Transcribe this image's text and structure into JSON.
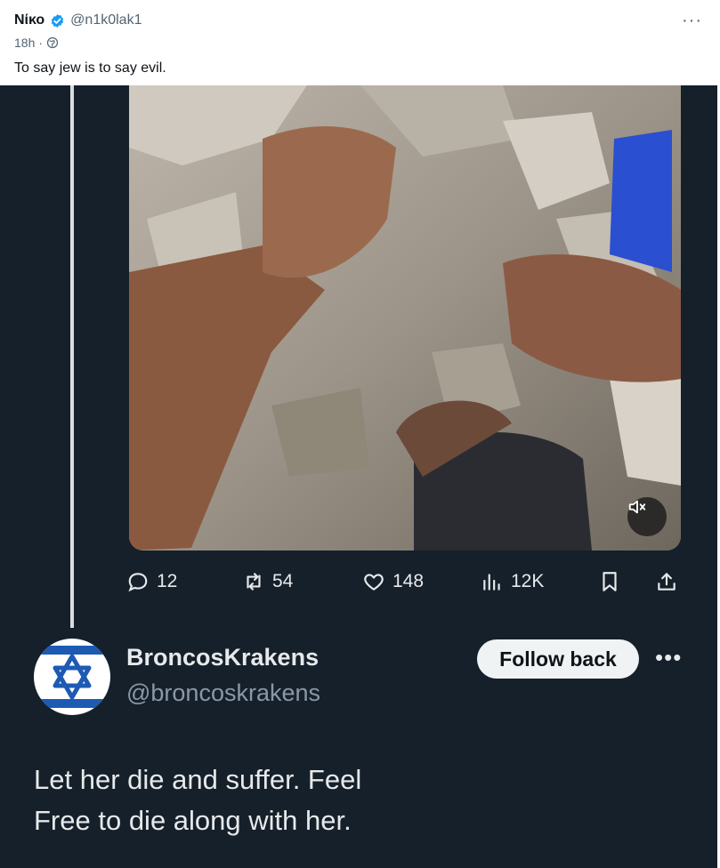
{
  "post": {
    "author_name": "Νίκο",
    "handle": "@n1k0lak1",
    "time": "18h",
    "dot": "·",
    "text": "To say jew is to say evil.",
    "more": "···",
    "icons": {
      "verified": "verified-badge-icon",
      "visibility": "globe-icon"
    },
    "colors": {
      "verified": "#1d9bf0"
    }
  },
  "embedded": {
    "background": "#15202b",
    "actions": {
      "replies": "12",
      "reposts": "54",
      "likes": "148",
      "views": "12K"
    },
    "quote": {
      "name": "BroncosKrakens",
      "handle": "@broncoskrakens",
      "follow_label": "Follow back",
      "more": "•••",
      "text_line1": "Let her die and suffer. Feel",
      "text_line2": "Free to die along with her."
    }
  }
}
